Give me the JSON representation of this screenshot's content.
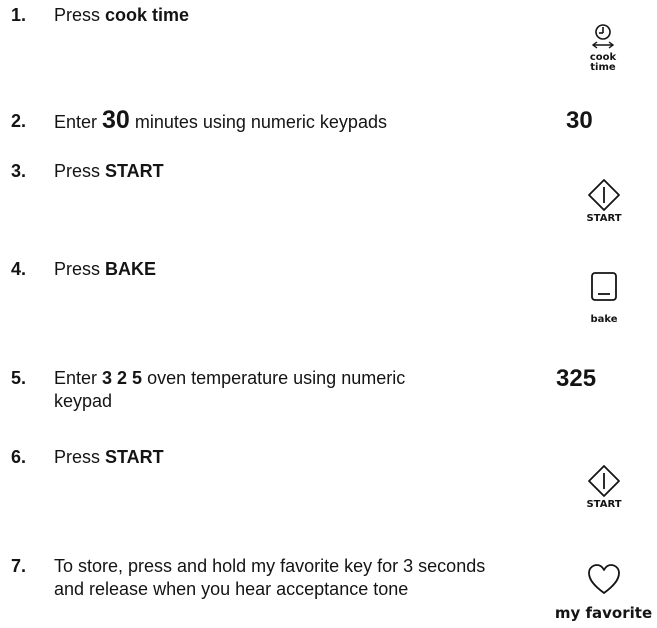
{
  "steps": [
    {
      "number": "1.",
      "pre": "Press ",
      "bold": "cook time",
      "post": ""
    },
    {
      "number": "2.",
      "pre": "Enter ",
      "bold": "30",
      "post": " minutes using numeric keypads"
    },
    {
      "number": "3.",
      "pre": "Press ",
      "bold": "START",
      "post": ""
    },
    {
      "number": "4.",
      "pre": "Press ",
      "bold": "BAKE",
      "post": ""
    },
    {
      "number": "5.",
      "pre": "Enter ",
      "bold": "3 2 5",
      "post": " oven temperature using numeric keypad"
    },
    {
      "number": "6.",
      "pre": "Press ",
      "bold": "START",
      "post": ""
    },
    {
      "number": "7.",
      "pre": "",
      "bold": "",
      "post": "To store, press and hold my favorite key for 3 seconds and release when you hear acceptance tone"
    }
  ],
  "icons": {
    "cook_time": {
      "name": "clock-arrows-icon",
      "line1": "cook",
      "line2": "time"
    },
    "start_1": {
      "name": "start-diamond-icon",
      "label": "START"
    },
    "bake": {
      "name": "bake-square-icon",
      "label": "bake"
    },
    "start_2": {
      "name": "start-diamond-icon",
      "label": "START"
    },
    "my_favorite": {
      "name": "heart-icon",
      "label": "my favorite"
    }
  },
  "readouts": {
    "time": "30",
    "temperature": "325"
  }
}
